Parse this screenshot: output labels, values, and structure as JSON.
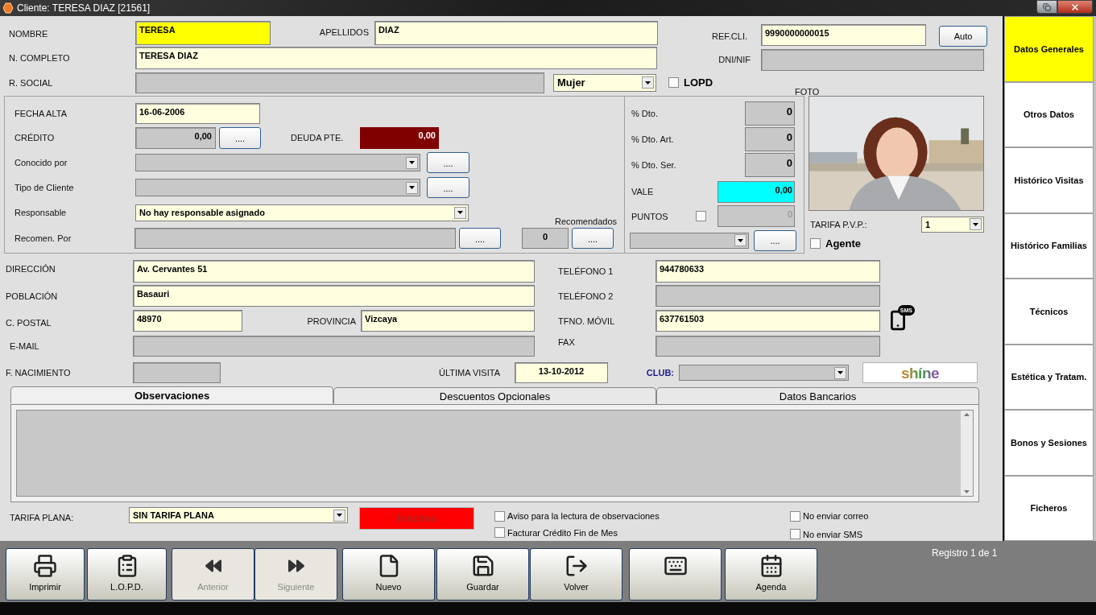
{
  "window": {
    "title": "Cliente: TERESA DIAZ [21561]"
  },
  "general": {
    "nombre": {
      "label": "NOMBRE",
      "value": "TERESA",
      "focused": true
    },
    "apellidos": {
      "label": "APELLIDOS",
      "value": "DIAZ",
      "focused": false,
      "disabled": false
    },
    "ref_cli": {
      "label": "REF.CLI.",
      "value": "9990000000015",
      "focused": false,
      "disabled": false,
      "button": "Auto"
    },
    "n_completo": {
      "label": "N. COMPLETO",
      "value": "TERESA DIAZ",
      "focused": false,
      "disabled": false
    },
    "dni_nif": {
      "label": "DNI/NIF",
      "focused": false,
      "disabled": true
    },
    "r_social": {
      "label": "R. SOCIAL",
      "focused": false,
      "disabled": true
    },
    "sexo": {
      "value": "Mujer"
    },
    "lopd": {
      "label": "LOPD",
      "checked": false
    },
    "foto": {
      "label": "FOTO"
    }
  },
  "datos": {
    "fecha_alta": {
      "label": "FECHA ALTA",
      "value": "16-06-2006",
      "focused": false,
      "disabled": false
    },
    "credito": {
      "label": "CRÉDITO",
      "value": "0,00",
      "focused": false,
      "disabled": true,
      "button": "...."
    },
    "deuda": {
      "label": "DEUDA PTE.",
      "value": "0,00"
    },
    "conocido_por": {
      "label": "Conocido por",
      "disabled": true,
      "button": "...."
    },
    "tipo_cliente": {
      "label": "Tipo de Cliente",
      "disabled": true,
      "button": "...."
    },
    "responsable": {
      "label": "Responsable",
      "value": "No hay responsable asignado",
      "disabled": false
    },
    "recomen_por": {
      "label": "Recomen. Por",
      "focused": false,
      "disabled": true,
      "button": "...."
    },
    "recomendados": {
      "label": "Recomendados",
      "value": "0",
      "button": "...."
    }
  },
  "descuentos": [
    {
      "label": "% Dto.",
      "value": "0"
    },
    {
      "label": "% Dto. Art.",
      "value": "0"
    },
    {
      "label": "% Dto. Ser.",
      "value": "0"
    }
  ],
  "vale": {
    "label": "VALE",
    "value": "0,00"
  },
  "puntos": {
    "label": "PUNTOS",
    "checked": false,
    "value": "0",
    "disabled": true,
    "button": "...."
  },
  "tarifa_pvp": {
    "label": "TARIFA P.V.P.:",
    "value": "1"
  },
  "agente": {
    "label": "Agente",
    "checked": false
  },
  "direccion": {
    "direccion": {
      "label": "DIRECCIÓN",
      "value": "Av. Cervantes 51",
      "focused": false,
      "disabled": false
    },
    "poblacion": {
      "label": "POBLACIÓN",
      "value": "Basauri",
      "focused": false,
      "disabled": false
    },
    "c_postal": {
      "label": "C. POSTAL",
      "value": "48970",
      "focused": false,
      "disabled": false
    },
    "provincia": {
      "label": "PROVINCIA",
      "value": "Vizcaya",
      "focused": false,
      "disabled": false
    },
    "email": {
      "label": "E-MAIL",
      "focused": false,
      "disabled": true
    },
    "f_nacimiento": {
      "label": "F. NACIMIENTO",
      "focused": false,
      "disabled": true
    },
    "ultima_visita": {
      "label": "ÚLTIMA VISITA",
      "value": "13-10-2012",
      "focused": false,
      "disabled": false
    },
    "telefono1": {
      "label": "TELÉFONO 1",
      "value": "944780633",
      "focused": false,
      "disabled": false
    },
    "telefono2": {
      "label": "TELÉFONO 2",
      "focused": false,
      "disabled": true
    },
    "movil": {
      "label": "TFNO. MÓVIL",
      "value": "637761503",
      "focused": false,
      "disabled": false,
      "sms": "SMS"
    },
    "fax": {
      "label": "FAX",
      "focused": false,
      "disabled": true
    },
    "club": {
      "label": "CLUB:",
      "disabled": true
    },
    "logo": "shíne"
  },
  "tabs": [
    {
      "label": "Observaciones",
      "selected": true
    },
    {
      "label": "Descuentos Opcionales",
      "selected": false
    },
    {
      "label": "Datos Bancarios",
      "selected": false
    }
  ],
  "tarifa_plana": {
    "label": "TARIFA PLANA:",
    "value": "SIN TARIFA PLANA"
  },
  "status": {
    "label": "Inactiva"
  },
  "options": [
    {
      "label": "Aviso para la lectura de observaciones",
      "checked": false
    },
    {
      "label": "Facturar Crédito Fin de Mes",
      "checked": false
    },
    {
      "label": "No enviar correo",
      "checked": false
    },
    {
      "label": "No enviar SMS",
      "checked": false
    }
  ],
  "sidebar": {
    "items": [
      {
        "label": "Datos Generales",
        "selected": true
      },
      {
        "label": "Otros Datos",
        "selected": false
      },
      {
        "label": "Histórico Visitas",
        "selected": false
      },
      {
        "label": "Histórico Familias",
        "selected": false
      },
      {
        "label": "Técnicos",
        "selected": false
      },
      {
        "label": "Estética y Tratam.",
        "selected": false
      },
      {
        "label": "Bonos y Sesiones",
        "selected": false
      },
      {
        "label": "Ficheros",
        "selected": false
      }
    ]
  },
  "toolbar": [
    {
      "kind": "print",
      "label": "Imprimir",
      "disabled": false
    },
    {
      "kind": "clipboard",
      "label": "L.O.P.D.",
      "disabled": false
    },
    {
      "kind": "previous",
      "label": "Anterior",
      "disabled": true
    },
    {
      "kind": "next",
      "label": "Siguiente",
      "disabled": true
    },
    {
      "kind": "new",
      "label": "Nuevo",
      "disabled": false
    },
    {
      "kind": "save",
      "label": "Guardar",
      "disabled": false
    },
    {
      "kind": "exit",
      "label": "Volver",
      "disabled": false
    },
    {
      "kind": "keyboard",
      "disabled": false
    },
    {
      "kind": "calendar",
      "label": "Agenda",
      "disabled": false
    }
  ],
  "status_bar": {
    "record": "Registro 1 de 1"
  }
}
